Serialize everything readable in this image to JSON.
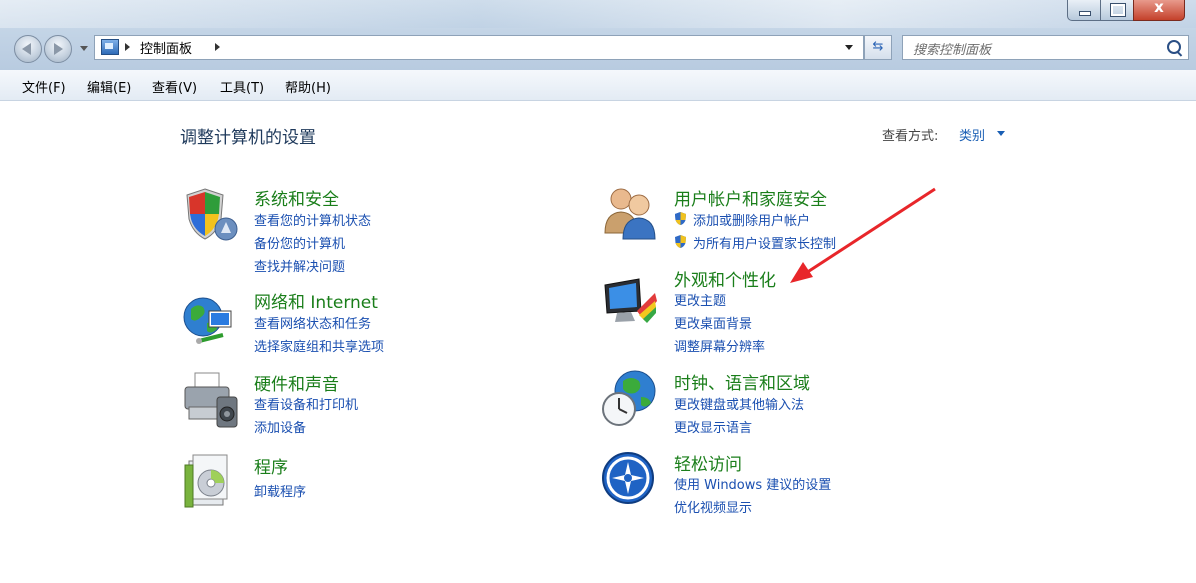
{
  "window": {
    "close_glyph": "x",
    "breadcrumb": "控制面板",
    "search_placeholder": "搜索控制面板"
  },
  "menu": [
    {
      "label": "文件(F)"
    },
    {
      "label": "编辑(E)"
    },
    {
      "label": "查看(V)"
    },
    {
      "label": "工具(T)"
    },
    {
      "label": "帮助(H)"
    }
  ],
  "header": {
    "title": "调整计算机的设置",
    "view_by_label": "查看方式:",
    "view_by_value": "类别"
  },
  "categories": {
    "system": {
      "title": "系统和安全",
      "links": [
        "查看您的计算机状态",
        "备份您的计算机",
        "查找并解决问题"
      ]
    },
    "network": {
      "title": "网络和 Internet",
      "links": [
        "查看网络状态和任务",
        "选择家庭组和共享选项"
      ]
    },
    "hardware": {
      "title": "硬件和声音",
      "links": [
        "查看设备和打印机",
        "添加设备"
      ]
    },
    "programs": {
      "title": "程序",
      "links": [
        "卸载程序"
      ]
    },
    "users": {
      "title": "用户帐户和家庭安全",
      "links": [
        "添加或删除用户帐户",
        "为所有用户设置家长控制"
      ]
    },
    "appearance": {
      "title": "外观和个性化",
      "links": [
        "更改主题",
        "更改桌面背景",
        "调整屏幕分辨率"
      ]
    },
    "clock": {
      "title": "时钟、语言和区域",
      "links": [
        "更改键盘或其他输入法",
        "更改显示语言"
      ]
    },
    "ease": {
      "title": "轻松访问",
      "links": [
        "使用 Windows 建议的设置",
        "优化视频显示"
      ]
    }
  },
  "colors": {
    "category_title": "#1a7e1a",
    "link": "#1a4fb0",
    "annotation_arrow": "#e8262a"
  }
}
